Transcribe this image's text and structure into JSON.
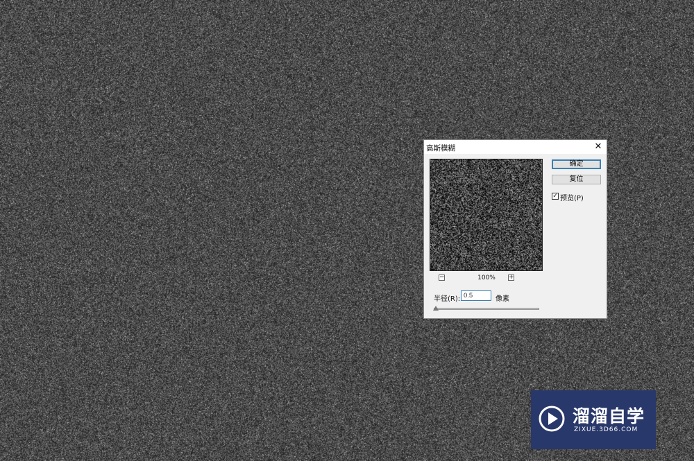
{
  "dialog": {
    "title": "高斯模糊",
    "close_glyph": "✕",
    "ok_label": "确定",
    "reset_label": "复位",
    "preview_checkbox": {
      "checked": true,
      "label": "预览(P)"
    },
    "zoom": {
      "minus": "−",
      "level": "100%",
      "plus": "+"
    },
    "radius": {
      "label": "半径(R):",
      "value": "0.5",
      "unit": "像素",
      "slider_fraction": 0.02
    }
  },
  "watermark": {
    "brand": "溜溜自学",
    "url": "ZIXUE.3D66.COM",
    "logo_icon": "play-icon",
    "background_color": "#29386a"
  },
  "canvas": {
    "background_noise_gray": "#4a4a4a"
  }
}
